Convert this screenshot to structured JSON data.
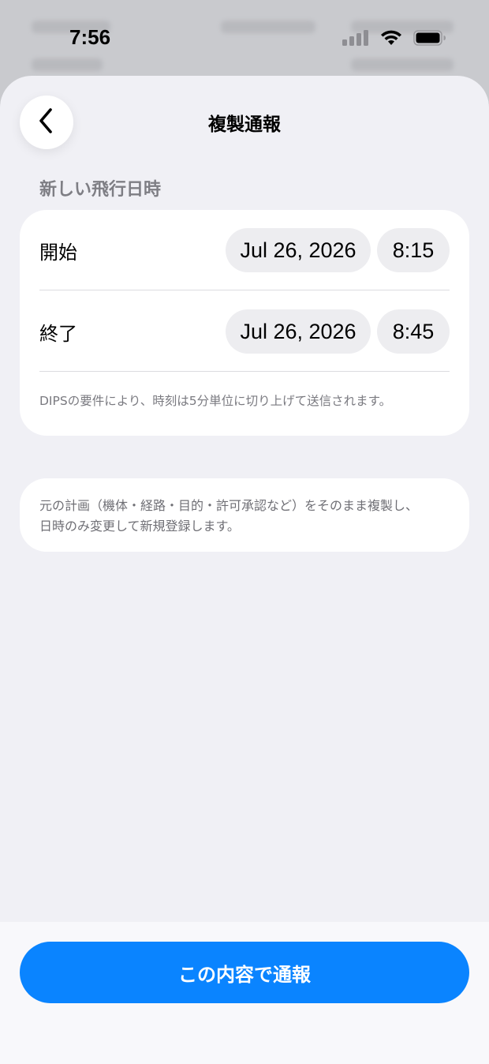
{
  "status_bar": {
    "time": "7:56"
  },
  "sheet": {
    "title": "複製通報"
  },
  "section": {
    "header": "新しい飛行日時"
  },
  "schedule": {
    "start": {
      "label": "開始",
      "date": "Jul 26, 2026",
      "time": "8:15"
    },
    "end": {
      "label": "終了",
      "date": "Jul 26, 2026",
      "time": "8:45"
    },
    "note": "DIPSの要件により、時刻は5分単位に切り上げて送信されます。"
  },
  "info": {
    "line1": "元の計画（機体・経路・目的・許可承認など）をそのまま複製し、",
    "line2": "日時のみ変更して新規登録します。"
  },
  "footer": {
    "submit_label": "この内容で通報"
  },
  "colors": {
    "accent": "#0a84ff",
    "background": "#f0f0f5",
    "card": "#ffffff"
  },
  "icons": {
    "back": "chevron-left-icon",
    "signal": "cellular-signal-icon",
    "wifi": "wifi-icon",
    "battery": "battery-icon"
  }
}
